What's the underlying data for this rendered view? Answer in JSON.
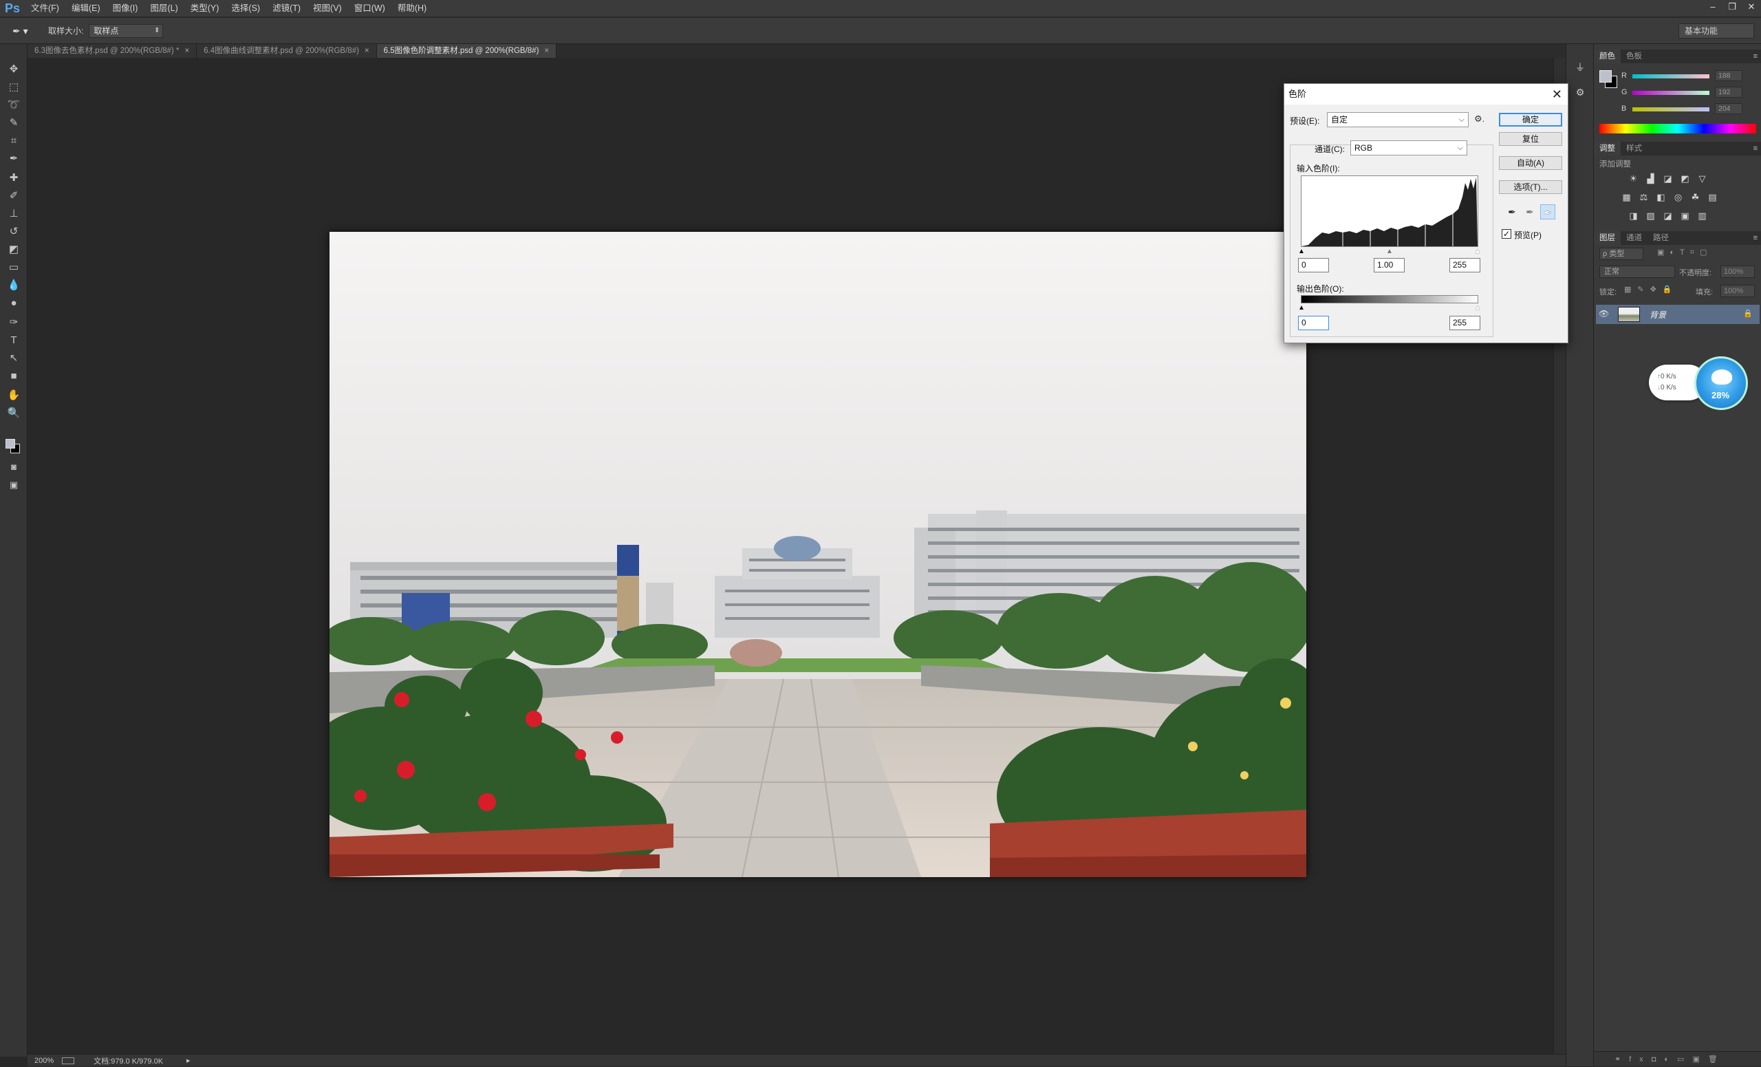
{
  "app": {
    "logo": "Ps"
  },
  "menu": [
    "文件(F)",
    "编辑(E)",
    "图像(I)",
    "图层(L)",
    "类型(Y)",
    "选择(S)",
    "滤镜(T)",
    "视图(V)",
    "窗口(W)",
    "帮助(H)"
  ],
  "window_controls": {
    "minimize": "–",
    "restore": "❐",
    "close": "✕"
  },
  "options_bar": {
    "tool_icon": "eyedropper-icon",
    "sample_size_label": "取样大小:",
    "sample_size_value": "取样点",
    "workspace": "基本功能"
  },
  "tabs": [
    {
      "label": "6.3图像去色素材.psd @ 200%(RGB/8#) *",
      "close": "×"
    },
    {
      "label": "6.4图像曲线调整素材.psd @ 200%(RGB/8#)",
      "close": "×"
    },
    {
      "label": "6.5图像色阶调整素材.psd @ 200%(RGB/8#)",
      "close": "×"
    }
  ],
  "status": {
    "zoom": "200%",
    "doc": "文档:979.0 K/979.0K",
    "arrow": "▸"
  },
  "dialog": {
    "title": "色阶",
    "close": "✕",
    "preset_label": "预设(E):",
    "preset_value": "自定",
    "channel_label": "通道(C):",
    "channel_value": "RGB",
    "input_label": "输入色阶(I):",
    "input_black": "0",
    "input_gamma": "1.00",
    "input_white": "255",
    "output_label": "输出色阶(O):",
    "output_black": "0",
    "output_white": "255",
    "buttons": {
      "ok": "确定",
      "reset": "复位",
      "auto": "自动(A)",
      "options": "选项(T)..."
    },
    "preview_label": "预览(P)",
    "preview_checked": true
  },
  "color_panel": {
    "tabs": [
      "颜色",
      "色板"
    ],
    "channels": [
      {
        "label": "R",
        "value": "188"
      },
      {
        "label": "G",
        "value": "192"
      },
      {
        "label": "B",
        "value": "204"
      }
    ],
    "foreground": "#bcc0cc"
  },
  "adjust_panel": {
    "tabs": [
      "调整",
      "样式"
    ],
    "subtitle": "添加调整"
  },
  "layers_panel": {
    "tabs": [
      "图层",
      "通道",
      "路径"
    ],
    "filter_kind": "ρ 类型",
    "blend_mode": "正常",
    "opacity_label": "不透明度:",
    "opacity_value": "100%",
    "lock_label": "锁定:",
    "fill_label": "填充:",
    "fill_value": "100%",
    "layer_name": "背景"
  },
  "net_widget": {
    "up": "0  K/s",
    "down": "0  K/s",
    "percent": "28%"
  }
}
